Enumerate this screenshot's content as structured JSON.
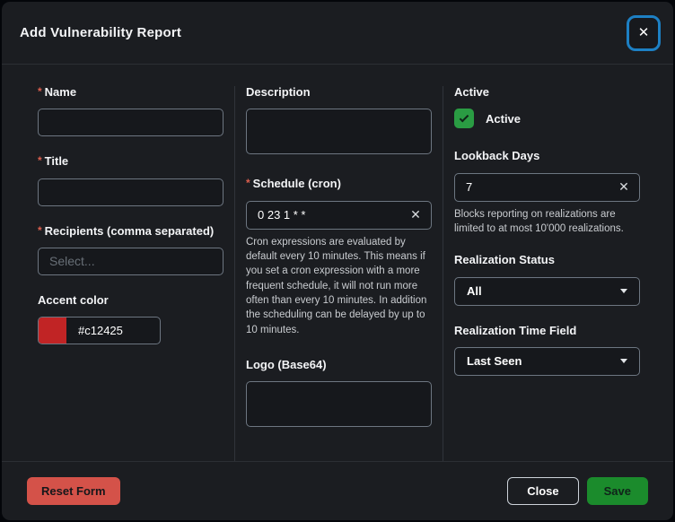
{
  "header": {
    "title": "Add Vulnerability Report"
  },
  "icons": {
    "close_x": "✕",
    "clear_x": "✕"
  },
  "required_marker": "*",
  "fields": {
    "name": {
      "label": "Name",
      "required": true
    },
    "title": {
      "label": "Title",
      "required": true
    },
    "recipients": {
      "label": "Recipients (comma separated)",
      "required": true,
      "placeholder": "Select..."
    },
    "accent": {
      "label": "Accent color",
      "value": "#c12425",
      "swatch_color": "#c12425"
    },
    "description": {
      "label": "Description"
    },
    "schedule": {
      "label": "Schedule (cron)",
      "required": true,
      "value": "0 23 1 * *",
      "help": "Cron expressions are evaluated by default every 10 minutes. This means if you set a cron expression with a more frequent schedule, it will not run more often than every 10 minutes. In addition the scheduling can be delayed by up to 10 minutes."
    },
    "logo": {
      "label": "Logo (Base64)"
    },
    "active": {
      "label": "Active",
      "checkbox_label": "Active",
      "checked": true
    },
    "lookback": {
      "label": "Lookback Days",
      "value": "7",
      "help": "Blocks reporting on realizations are limited to at most 10'000 realizations."
    },
    "realization_status": {
      "label": "Realization Status",
      "value": "All"
    },
    "realization_time": {
      "label": "Realization Time Field",
      "value": "Last Seen"
    }
  },
  "footer": {
    "reset": "Reset Form",
    "close": "Close",
    "save": "Save"
  },
  "colors": {
    "accent_red": "#c12425",
    "checkbox_green": "#2a9c43",
    "save_green": "#1b8b2c",
    "reset_red": "#d45249",
    "focus_blue": "#1d80c4"
  }
}
